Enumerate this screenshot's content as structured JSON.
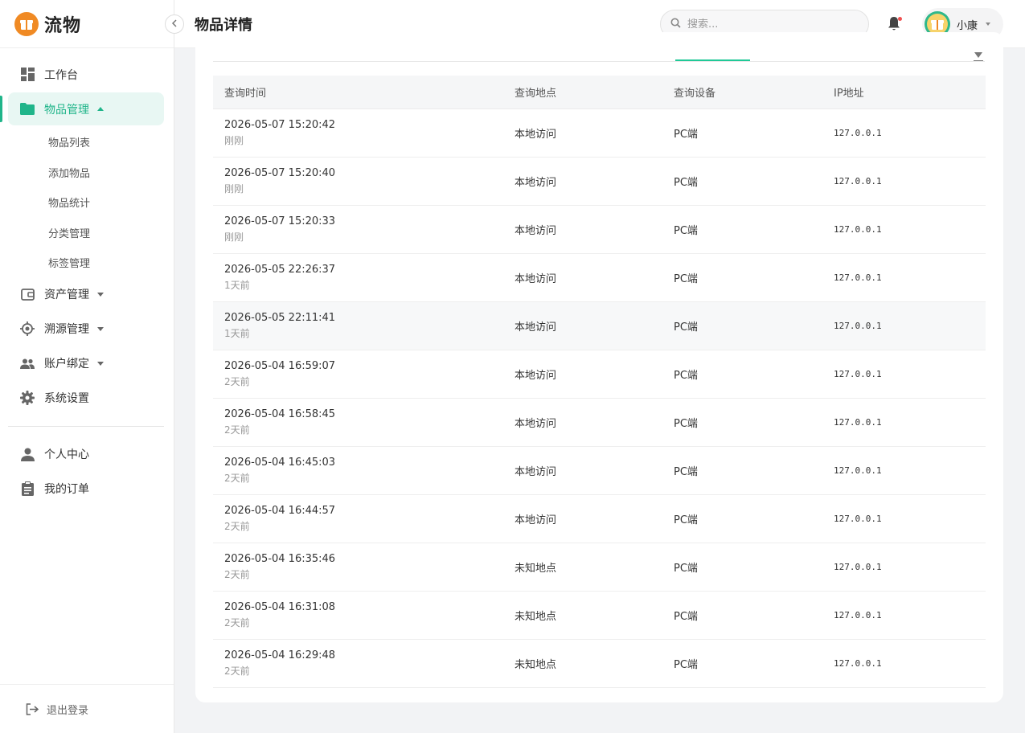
{
  "brand": {
    "name": "流物",
    "accent": "#20b58a",
    "logo_color": "#f08a24"
  },
  "header": {
    "title": "物品详情",
    "search_placeholder": "搜索...",
    "user_name": "小康"
  },
  "sidebar": {
    "items": [
      {
        "label": "工作台",
        "icon": "dashboard-icon"
      },
      {
        "label": "物品管理",
        "icon": "folder-icon",
        "active": true,
        "children": [
          "物品列表",
          "添加物品",
          "物品统计",
          "分类管理",
          "标签管理"
        ]
      },
      {
        "label": "资产管理",
        "icon": "wallet-icon"
      },
      {
        "label": "溯源管理",
        "icon": "target-icon"
      },
      {
        "label": "账户绑定",
        "icon": "users-icon"
      },
      {
        "label": "系统设置",
        "icon": "gear-icon"
      }
    ],
    "bottom_items": [
      {
        "label": "个人中心",
        "icon": "person-icon"
      },
      {
        "label": "我的订单",
        "icon": "clipboard-icon"
      }
    ],
    "logout_label": "退出登录"
  },
  "table": {
    "columns": [
      "查询时间",
      "查询地点",
      "查询设备",
      "IP地址"
    ],
    "rows": [
      {
        "time": "2026-05-07 15:20:42",
        "relative": "刚刚",
        "location": "本地访问",
        "device": "PC端",
        "ip": "127.0.0.1"
      },
      {
        "time": "2026-05-07 15:20:40",
        "relative": "刚刚",
        "location": "本地访问",
        "device": "PC端",
        "ip": "127.0.0.1"
      },
      {
        "time": "2026-05-07 15:20:33",
        "relative": "刚刚",
        "location": "本地访问",
        "device": "PC端",
        "ip": "127.0.0.1"
      },
      {
        "time": "2026-05-05 22:26:37",
        "relative": "1天前",
        "location": "本地访问",
        "device": "PC端",
        "ip": "127.0.0.1"
      },
      {
        "time": "2026-05-05 22:11:41",
        "relative": "1天前",
        "location": "本地访问",
        "device": "PC端",
        "ip": "127.0.0.1"
      },
      {
        "time": "2026-05-04 16:59:07",
        "relative": "2天前",
        "location": "本地访问",
        "device": "PC端",
        "ip": "127.0.0.1"
      },
      {
        "time": "2026-05-04 16:58:45",
        "relative": "2天前",
        "location": "本地访问",
        "device": "PC端",
        "ip": "127.0.0.1"
      },
      {
        "time": "2026-05-04 16:45:03",
        "relative": "2天前",
        "location": "本地访问",
        "device": "PC端",
        "ip": "127.0.0.1"
      },
      {
        "time": "2026-05-04 16:44:57",
        "relative": "2天前",
        "location": "本地访问",
        "device": "PC端",
        "ip": "127.0.0.1"
      },
      {
        "time": "2026-05-04 16:35:46",
        "relative": "2天前",
        "location": "未知地点",
        "device": "PC端",
        "ip": "127.0.0.1"
      },
      {
        "time": "2026-05-04 16:31:08",
        "relative": "2天前",
        "location": "未知地点",
        "device": "PC端",
        "ip": "127.0.0.1"
      },
      {
        "time": "2026-05-04 16:29:48",
        "relative": "2天前",
        "location": "未知地点",
        "device": "PC端",
        "ip": "127.0.0.1"
      }
    ]
  }
}
